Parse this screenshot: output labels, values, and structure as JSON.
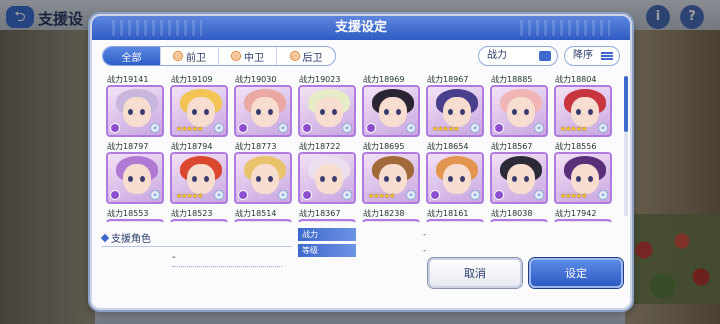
{
  "background": {
    "title": "支援设",
    "icons": [
      {
        "name": "info",
        "glyph": "i"
      },
      {
        "name": "help",
        "glyph": "?"
      }
    ]
  },
  "dialog": {
    "title": "支援设定",
    "tabs": [
      {
        "label": "全部",
        "active": true
      },
      {
        "label": "前卫",
        "active": false
      },
      {
        "label": "中卫",
        "active": false
      },
      {
        "label": "后卫",
        "active": false
      }
    ],
    "sort_field": "战力",
    "sort_order": "降序",
    "characters": [
      {
        "power": "战力19141",
        "stars": "",
        "hair": "#c8b6dc"
      },
      {
        "power": "战力19109",
        "stars": "★★★★★",
        "hair": "#f2c455"
      },
      {
        "power": "战力19030",
        "stars": "",
        "hair": "#e9a9a2"
      },
      {
        "power": "战力19023",
        "stars": "",
        "hair": "#e7ecc8"
      },
      {
        "power": "战力18969",
        "stars": "",
        "hair": "#2a2533"
      },
      {
        "power": "战力18967",
        "stars": "★★★★★",
        "hair": "#4a3f8c"
      },
      {
        "power": "战力18885",
        "stars": "",
        "hair": "#f0b6b6"
      },
      {
        "power": "战力18804",
        "stars": "★★★★★",
        "hair": "#c7353e"
      },
      {
        "power": "战力18797",
        "stars": "",
        "hair": "#b079d4"
      },
      {
        "power": "战力18794",
        "stars": "★★★★★",
        "hair": "#d9482f"
      },
      {
        "power": "战力18773",
        "stars": "",
        "hair": "#e8c36b"
      },
      {
        "power": "战力18722",
        "stars": "",
        "hair": "#ece0ee"
      },
      {
        "power": "战力18695",
        "stars": "★★★★★",
        "hair": "#a26a3a"
      },
      {
        "power": "战力18654",
        "stars": "",
        "hair": "#e3964f"
      },
      {
        "power": "战力18567",
        "stars": "",
        "hair": "#2d2a38"
      },
      {
        "power": "战力18556",
        "stars": "★★★★★",
        "hair": "#5a2f7a"
      },
      {
        "power": "战力18553",
        "stars": "",
        "hair": "#b8a6d8"
      },
      {
        "power": "战力18523",
        "stars": "",
        "hair": "#d44a3a"
      },
      {
        "power": "战力18514",
        "stars": "",
        "hair": "#f0d39a"
      },
      {
        "power": "战力18367",
        "stars": "",
        "hair": "#e6d7c4"
      },
      {
        "power": "战力18238",
        "stars": "",
        "hair": "#f1c36a"
      },
      {
        "power": "战力18161",
        "stars": "",
        "hair": "#ecc8d2"
      },
      {
        "power": "战力18038",
        "stars": "",
        "hair": "#3a3342"
      },
      {
        "power": "战力17942",
        "stars": "",
        "hair": "#e0a06a"
      }
    ],
    "support_title": "支援角色",
    "support_dash": "-",
    "stats": [
      {
        "label": "战力",
        "value": "-"
      },
      {
        "label": "等级",
        "value": "-"
      }
    ],
    "cancel_label": "取消",
    "confirm_label": "设定"
  }
}
